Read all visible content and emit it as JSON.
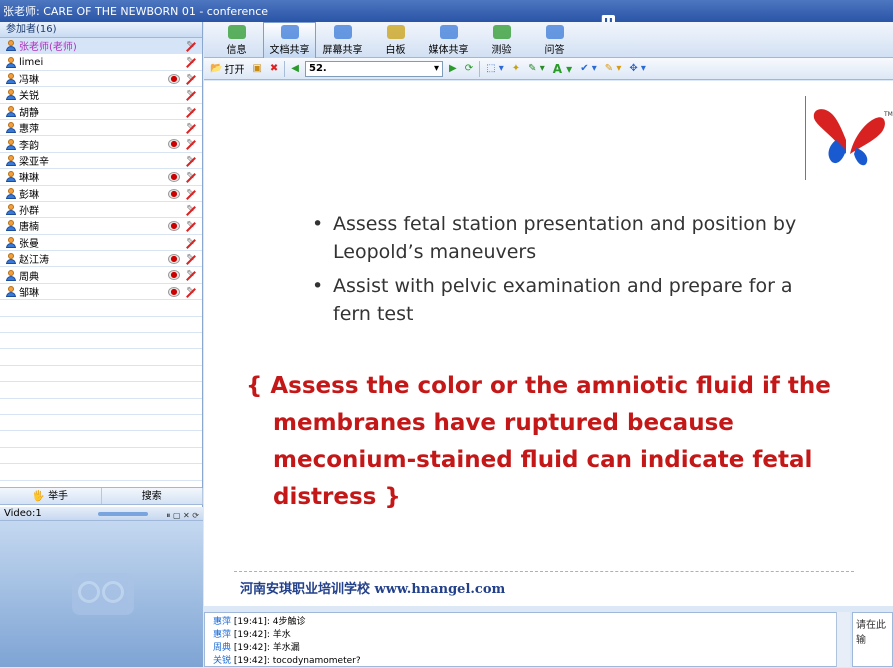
{
  "window": {
    "title": "张老师: CARE OF THE NEWBORN 01 - conference"
  },
  "participants": {
    "header": "参加者(16)",
    "list": [
      {
        "name": "张老师(老师)",
        "teacher": true,
        "cam": false
      },
      {
        "name": "limei",
        "cam": false
      },
      {
        "name": "冯琳",
        "cam": true
      },
      {
        "name": "关锐",
        "cam": false
      },
      {
        "name": "胡静",
        "cam": false
      },
      {
        "name": "惠萍",
        "cam": false
      },
      {
        "name": "李韵",
        "cam": true
      },
      {
        "name": "梁亚辛",
        "cam": false
      },
      {
        "name": "琳琳",
        "cam": true
      },
      {
        "name": "彭琳",
        "cam": true
      },
      {
        "name": "孙群",
        "cam": false
      },
      {
        "name": "唐楠",
        "cam": true
      },
      {
        "name": "张曼",
        "cam": false
      },
      {
        "name": "赵江涛",
        "cam": true
      },
      {
        "name": "周典",
        "cam": true
      },
      {
        "name": "邹琳",
        "cam": true
      }
    ]
  },
  "actions": {
    "raise_hand": "举手",
    "search": "搜索"
  },
  "video": {
    "label": "Video:1"
  },
  "tabs": [
    "信息",
    "文档共享",
    "屏幕共享",
    "白板",
    "媒体共享",
    "测验",
    "问答"
  ],
  "toolbar": {
    "open": "打开",
    "page": "52."
  },
  "slide": {
    "bullets": [
      "Assess fetal station presentation and position by Leopold’s maneuvers",
      "Assist with pelvic examination and prepare for a fern test"
    ],
    "red_lines": [
      "{ Assess the color or the amniotic fluid if the",
      "membranes have ruptured because",
      "meconium-stained fluid can indicate fetal",
      "distress }"
    ],
    "footer": "河南安琪职业培训学校  www.hnangel.com",
    "logo_tm": "TM"
  },
  "chat": {
    "lines": [
      {
        "name": "惠萍",
        "text": "[19:41]: 4步触诊"
      },
      {
        "name": "惠萍",
        "text": "[19:42]: 羊水"
      },
      {
        "name": "周典",
        "text": "[19:42]: 羊水漏"
      },
      {
        "name": "关锐",
        "text": "[19:42]: tocodynamometer?"
      }
    ],
    "input_placeholder": "请在此输"
  },
  "colors": {
    "accent": "#2a54a6",
    "red_text": "#c41818"
  }
}
